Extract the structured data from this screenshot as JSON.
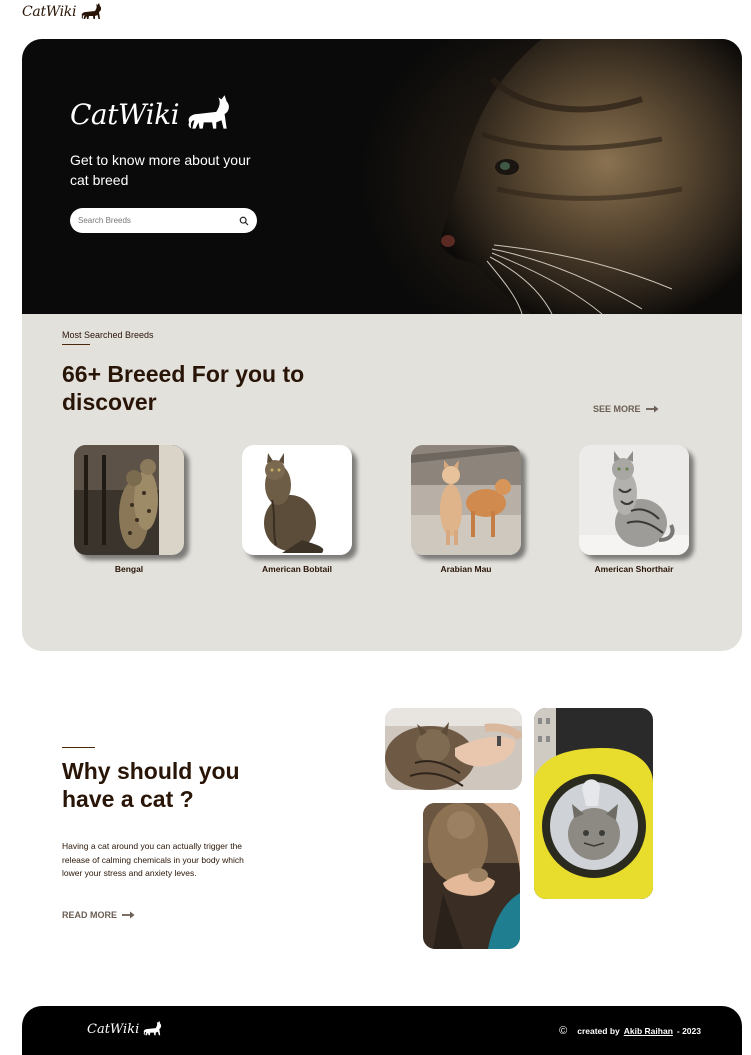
{
  "brand": {
    "name": "CatWiki"
  },
  "hero": {
    "tagline": "Get to know more about your cat breed",
    "search_placeholder": "Search Breeds"
  },
  "breeds_section": {
    "eyebrow": "Most Searched Breeds",
    "heading": "66+ Breeed For you to discover",
    "see_more": "SEE MORE",
    "breeds": [
      {
        "name": "Bengal"
      },
      {
        "name": "American Bobtail"
      },
      {
        "name": "Arabian Mau"
      },
      {
        "name": "American Shorthair"
      }
    ]
  },
  "why_section": {
    "heading": "Why should you have a cat ?",
    "text": "Having a cat around you can actually trigger the release of calming chemicals in your body which lower your stress and anxiety leves.",
    "read_more": "READ MORE"
  },
  "footer": {
    "copyright_symbol": "©",
    "created_by": "created by",
    "author": "Akib Raihan",
    "year_suffix": "- 2023"
  },
  "colors": {
    "text_dark": "#291507",
    "section_bg": "#e3e1dc",
    "footer_bg": "#000000",
    "link_muted": "#6b5e54"
  },
  "icons": [
    "cat-silhouette-icon",
    "search-icon",
    "arrow-right-icon",
    "copyright-icon"
  ]
}
